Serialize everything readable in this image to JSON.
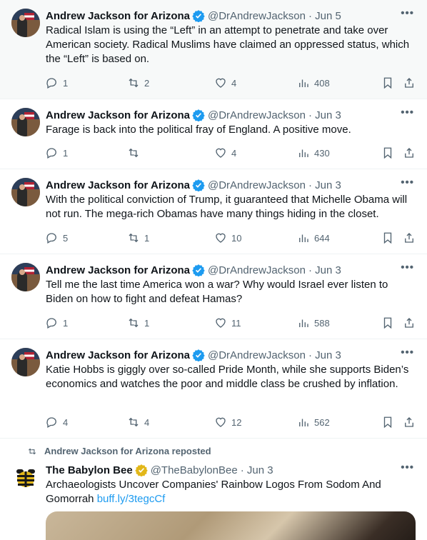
{
  "colors": {
    "accent": "#1d9bf0",
    "secondary_text": "#536471",
    "verified_blue": "#1d9bf0",
    "verified_gold": "#e2b719"
  },
  "tweets": [
    {
      "name": "Andrew Jackson for Arizona",
      "handle": "@DrAndrewJackson",
      "date": "· Jun 5",
      "text": "Radical Islam is using the “Left” in an attempt to penetrate and take over American society. Radical Muslims have claimed an oppressed status, which the “Left” is based on.",
      "replies": "1",
      "reposts": "2",
      "likes": "4",
      "views": "408"
    },
    {
      "name": "Andrew Jackson for Arizona",
      "handle": "@DrAndrewJackson",
      "date": "· Jun 3",
      "text": "Farage is back into the political fray of England. A positive move.",
      "replies": "1",
      "reposts": "",
      "likes": "4",
      "views": "430"
    },
    {
      "name": "Andrew Jackson for Arizona",
      "handle": "@DrAndrewJackson",
      "date": "· Jun 3",
      "text": "With the political conviction of Trump, it guaranteed that Michelle Obama will not run. The mega-rich Obamas have many things hiding in the closet.",
      "replies": "5",
      "reposts": "1",
      "likes": "10",
      "views": "644"
    },
    {
      "name": "Andrew Jackson for Arizona",
      "handle": "@DrAndrewJackson",
      "date": "· Jun 3",
      "text": "Tell me the last time America won a war? Why would Israel ever listen to Biden on how to fight and defeat Hamas?",
      "replies": "1",
      "reposts": "1",
      "likes": "11",
      "views": "588"
    },
    {
      "name": "Andrew Jackson for Arizona",
      "handle": "@DrAndrewJackson",
      "date": "· Jun 3",
      "text": "Katie Hobbs is giggly over so-called Pride Month, while she supports Biden’s economics and watches the poor and middle class be crushed by inflation.",
      "replies": "4",
      "reposts": "4",
      "likes": "12",
      "views": "562"
    }
  ],
  "repost": {
    "label": "Andrew Jackson for Arizona reposted",
    "name": "The Babylon Bee",
    "handle": "@TheBabylonBee",
    "date": "· Jun 3",
    "text": "Archaeologists Uncover Companies' Rainbow Logos From Sodom And Gomorrah",
    "link": "buff.ly/3tegcCf"
  }
}
